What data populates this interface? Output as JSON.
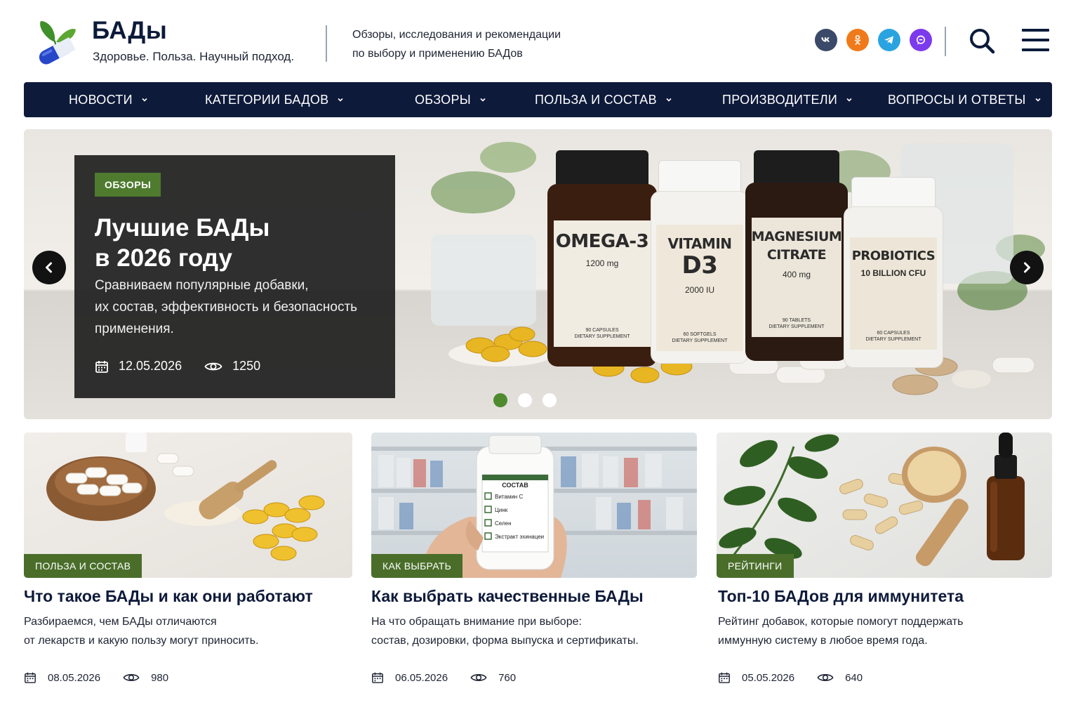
{
  "brand": {
    "title": "БАДы",
    "tagline": "Здоровье. Польза. Научный подход.",
    "description_line1": "Обзоры, исследования и рекомендации",
    "description_line2": "по выбору и применению БАДов"
  },
  "socials": [
    {
      "name": "vk",
      "icon": "vk-icon",
      "color": "#3a4a68"
    },
    {
      "name": "ok",
      "icon": "odnoklassniki-icon",
      "color": "#f07a1a"
    },
    {
      "name": "telegram",
      "icon": "telegram-icon",
      "color": "#2aa4e0"
    },
    {
      "name": "max",
      "icon": "chat-icon",
      "color": "#7c3aed"
    }
  ],
  "nav": {
    "items": [
      {
        "label": "НОВОСТИ"
      },
      {
        "label": "КАТЕГОРИИ БАДОВ"
      },
      {
        "label": "ОБЗОРЫ"
      },
      {
        "label": "ПОЛЬЗА И СОСТАВ"
      },
      {
        "label": "ПРОИЗВОДИТЕЛИ"
      },
      {
        "label": "ВОПРОСЫ И ОТВЕТЫ"
      }
    ]
  },
  "hero": {
    "badge": "ОБЗОРЫ",
    "title_line1": "Лучшие БАДы",
    "title_line2": "в 2026 году",
    "subtitle_line1": "Сравниваем популярные добавки,",
    "subtitle_line2": "их состав, эффективность и безопасность",
    "subtitle_line3": "применения.",
    "date": "12.05.2026",
    "views": "1250",
    "slides_total": 3,
    "active_slide": 1,
    "bottles": [
      {
        "name_1": "OMEGA-3",
        "name_2": "",
        "dose": "1200 mg",
        "foot_1": "90 CAPSULES",
        "foot_2": "DIETARY SUPPLEMENT"
      },
      {
        "name_1": "VITAMIN",
        "name_2": "D3",
        "dose": "2000 IU",
        "foot_1": "60 SOFTGELS",
        "foot_2": "DIETARY SUPPLEMENT"
      },
      {
        "name_1": "MAGNESIUM",
        "name_2": "CITRATE",
        "dose": "400 mg",
        "foot_1": "90 TABLETS",
        "foot_2": "DIETARY SUPPLEMENT"
      },
      {
        "name_1": "PROBIOTICS",
        "name_2": "10 BILLION CFU",
        "dose": "",
        "foot_1": "60 CAPSULES",
        "foot_2": "DIETARY SUPPLEMENT"
      }
    ]
  },
  "cards": [
    {
      "badge": "ПОЛЬЗА И СОСТАВ",
      "title": "Что такое БАДы и как они работают",
      "desc_line1": "Разбираемся, чем БАДы отличаются",
      "desc_line2": "от лекарств и какую пользу могут приносить.",
      "date": "08.05.2026",
      "views": "980"
    },
    {
      "badge": "КАК ВЫБРАТЬ",
      "title": "Как выбрать качественные БАДы",
      "desc_line1": "На что обращать внимание при выборе:",
      "desc_line2": "состав, дозировки, форма выпуска и сертификаты.",
      "date": "06.05.2026",
      "views": "760",
      "jar_label": {
        "title": "СОСТАВ",
        "items": [
          "Витамин С",
          "Цинк",
          "Селен",
          "Экстракт эхинацеи"
        ]
      }
    },
    {
      "badge": "РЕЙТИНГИ",
      "title": "Топ-10 БАДов для иммунитета",
      "desc_line1": "Рейтинг добавок, которые помогут поддержать",
      "desc_line2": "иммунную систему в любое время года.",
      "date": "05.05.2026",
      "views": "640"
    }
  ],
  "colors": {
    "nav_bg": "#0e1a3a",
    "accent_green": "#4e7b2e",
    "badge_green": "#4a6e2a",
    "title_navy": "#0e1a3a"
  }
}
